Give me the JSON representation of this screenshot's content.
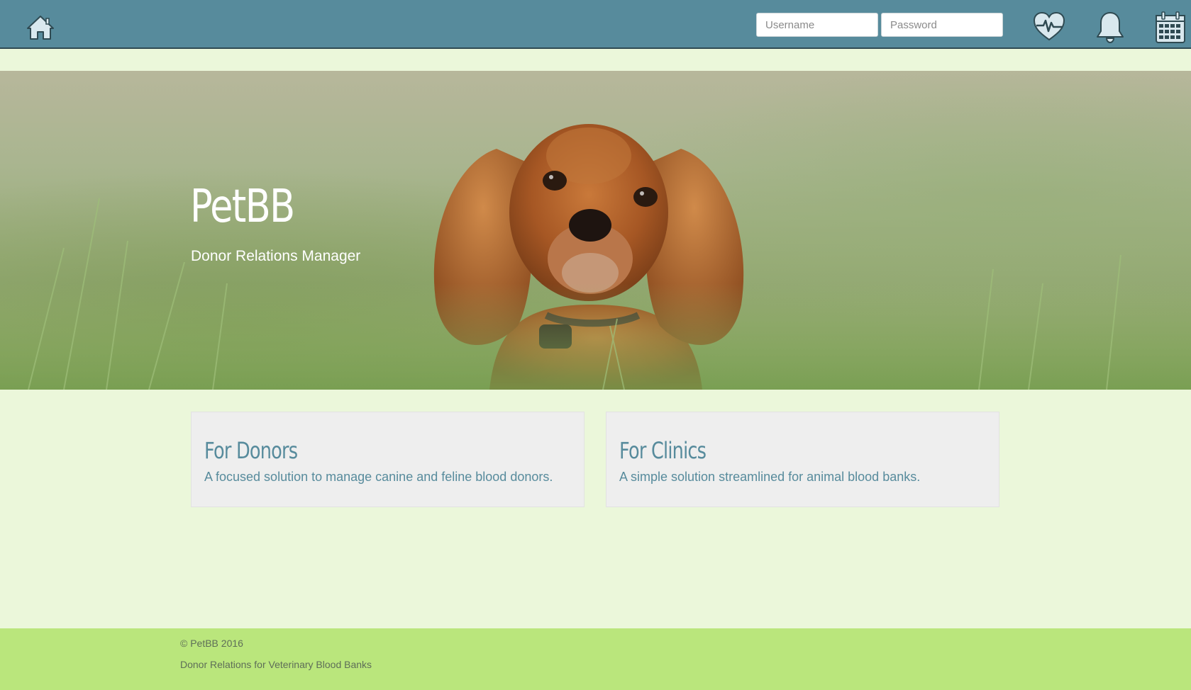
{
  "nav": {
    "home_icon": "home-icon",
    "username_placeholder": "Username",
    "password_placeholder": "Password",
    "icons": [
      "heart-pulse-icon",
      "bell-icon",
      "calendar-icon"
    ]
  },
  "hero": {
    "title": "PetBB",
    "subtitle": "Donor Relations Manager"
  },
  "cards": [
    {
      "title": "For Donors",
      "text": "A focused solution to manage canine and feline blood donors."
    },
    {
      "title": "For Clinics",
      "text": "A simple solution streamlined for animal blood banks."
    }
  ],
  "footer": {
    "copyright": "© PetBB 2016",
    "tagline": "Donor Relations for Veterinary Blood Banks"
  },
  "colors": {
    "nav_bg": "#578b9c",
    "page_bg": "#ebf7da",
    "card_bg": "#eeeeee",
    "accent_text": "#578b9c",
    "footer_bg": "#bae67c",
    "icon_fill": "#d9e8ee"
  }
}
